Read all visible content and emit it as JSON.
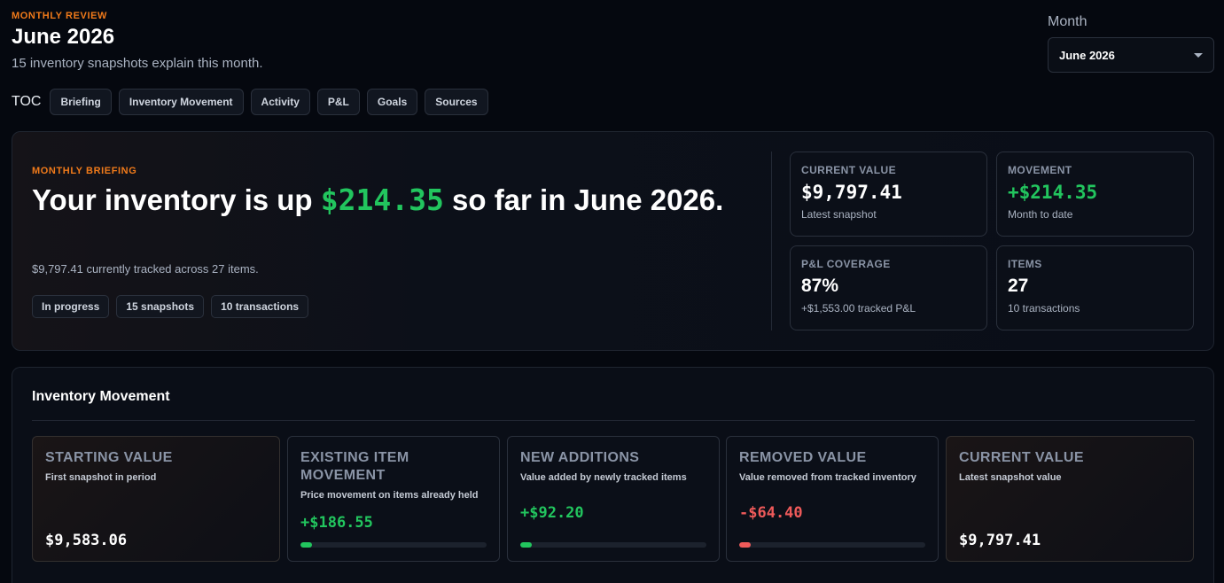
{
  "header": {
    "eyebrow": "MONTHLY REVIEW",
    "title": "June 2026",
    "subtitle": "15 inventory snapshots explain this month."
  },
  "month_picker": {
    "label": "Month",
    "selected": "June 2026"
  },
  "toc": {
    "label": "TOC",
    "items": [
      "Briefing",
      "Inventory Movement",
      "Activity",
      "P&L",
      "Goals",
      "Sources"
    ]
  },
  "briefing": {
    "eyebrow": "MONTHLY BRIEFING",
    "headline_prefix": "Your inventory is up ",
    "headline_amount": "$214.35",
    "headline_suffix": " so far in June 2026.",
    "description": "$9,797.41 currently tracked across 27 items.",
    "badges": [
      "In progress",
      "15 snapshots",
      "10 transactions"
    ],
    "stats": [
      {
        "label": "CURRENT VALUE",
        "value": "$9,797.41",
        "note": "Latest snapshot"
      },
      {
        "label": "MOVEMENT",
        "value": "+$214.35",
        "note": "Month to date"
      },
      {
        "label": "P&L COVERAGE",
        "value": "87%",
        "note": "+$1,553.00 tracked P&L"
      },
      {
        "label": "ITEMS",
        "value": "27",
        "note": "10 transactions"
      }
    ]
  },
  "movement": {
    "title": "Inventory Movement",
    "cards": [
      {
        "label": "STARTING VALUE",
        "sub": "First snapshot in period",
        "value": "$9,583.06"
      },
      {
        "label": "EXISTING ITEM MOVEMENT",
        "sub": "Price movement on items already held",
        "value": "+$186.55",
        "bar_fraction": 0.06
      },
      {
        "label": "NEW ADDITIONS",
        "sub": "Value added by newly tracked items",
        "value": "+$92.20",
        "bar_fraction": 0.06
      },
      {
        "label": "REMOVED VALUE",
        "sub": "Value removed from tracked inventory",
        "value": "-$64.40",
        "bar_fraction": 0.06
      },
      {
        "label": "CURRENT VALUE",
        "sub": "Latest snapshot value",
        "value": "$9,797.41"
      }
    ]
  },
  "colors": {
    "accent_orange": "#f07a1a",
    "positive": "#22c55e",
    "negative": "#ef5a5a",
    "background": "#05080f"
  }
}
